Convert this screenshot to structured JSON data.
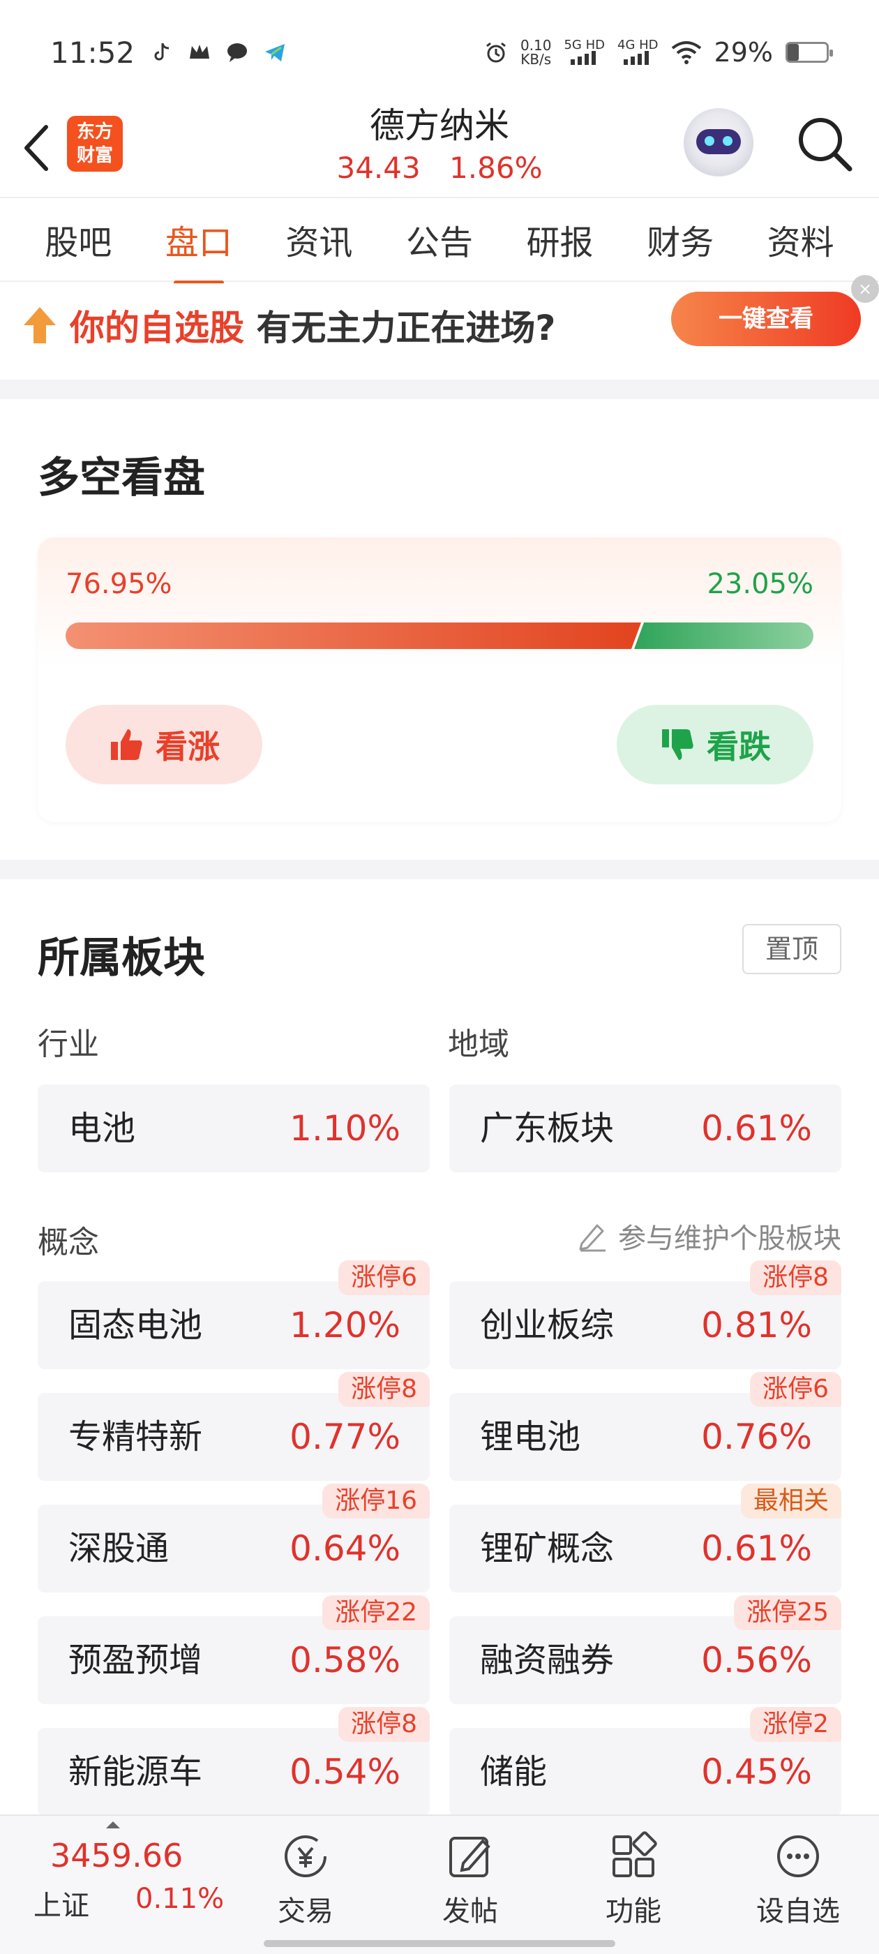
{
  "status_bar": {
    "time": "11:52",
    "net_speed_value": "0.10",
    "net_speed_unit": "KB/s",
    "sim1": "5G HD",
    "sim2": "4G HD",
    "battery_pct": "29%",
    "battery_level": 0.29
  },
  "header": {
    "logo_text_1": "东方",
    "logo_text_2": "财富",
    "stock_name": "德方纳米",
    "price": "34.43",
    "change_pct": "1.86%"
  },
  "tabs": [
    {
      "label": "股吧",
      "active": false
    },
    {
      "label": "盘口",
      "active": true
    },
    {
      "label": "资讯",
      "active": false
    },
    {
      "label": "公告",
      "active": false
    },
    {
      "label": "研报",
      "active": false
    },
    {
      "label": "财务",
      "active": false
    },
    {
      "label": "资料",
      "active": false
    }
  ],
  "promo": {
    "highlight": "你的自选股",
    "text": "有无主力正在进场?",
    "button": "一键查看",
    "close": "×"
  },
  "sentiment": {
    "title": "多空看盘",
    "bull_pct": "76.95%",
    "bear_pct": "23.05%",
    "bull_ratio": 0.7695,
    "bull_label": "看涨",
    "bear_label": "看跌"
  },
  "sectors": {
    "title": "所属板块",
    "pin_label": "置顶",
    "industry_label": "行业",
    "region_label": "地域",
    "industry": {
      "name": "电池",
      "pct": "1.10%"
    },
    "region": {
      "name": "广东板块",
      "pct": "0.61%"
    },
    "concept_label": "概念",
    "edit_link": "参与维护个股板块",
    "concepts": [
      {
        "name": "固态电池",
        "pct": "1.20%",
        "tag": "涨停6"
      },
      {
        "name": "创业板综",
        "pct": "0.81%",
        "tag": "涨停8"
      },
      {
        "name": "专精特新",
        "pct": "0.77%",
        "tag": "涨停8"
      },
      {
        "name": "锂电池",
        "pct": "0.76%",
        "tag": "涨停6"
      },
      {
        "name": "深股通",
        "pct": "0.64%",
        "tag": "涨停16"
      },
      {
        "name": "锂矿概念",
        "pct": "0.61%",
        "tag": "最相关"
      },
      {
        "name": "预盈预增",
        "pct": "0.58%",
        "tag": "涨停22"
      },
      {
        "name": "融资融券",
        "pct": "0.56%",
        "tag": "涨停25"
      },
      {
        "name": "新能源车",
        "pct": "0.54%",
        "tag": "涨停8"
      },
      {
        "name": "储能",
        "pct": "0.45%",
        "tag": "涨停2"
      }
    ]
  },
  "bottom_nav": {
    "index_value": "3459.66",
    "index_name": "上证",
    "index_pct": "0.11%",
    "items": [
      {
        "label": "交易",
        "icon": "yuan-exchange-icon"
      },
      {
        "label": "发帖",
        "icon": "edit-post-icon"
      },
      {
        "label": "功能",
        "icon": "grid-apps-icon"
      },
      {
        "label": "设自选",
        "icon": "more-dots-icon"
      }
    ]
  },
  "colors": {
    "up_red": "#e0322b",
    "down_green": "#1ea34a",
    "accent_orange": "#e8571e"
  }
}
